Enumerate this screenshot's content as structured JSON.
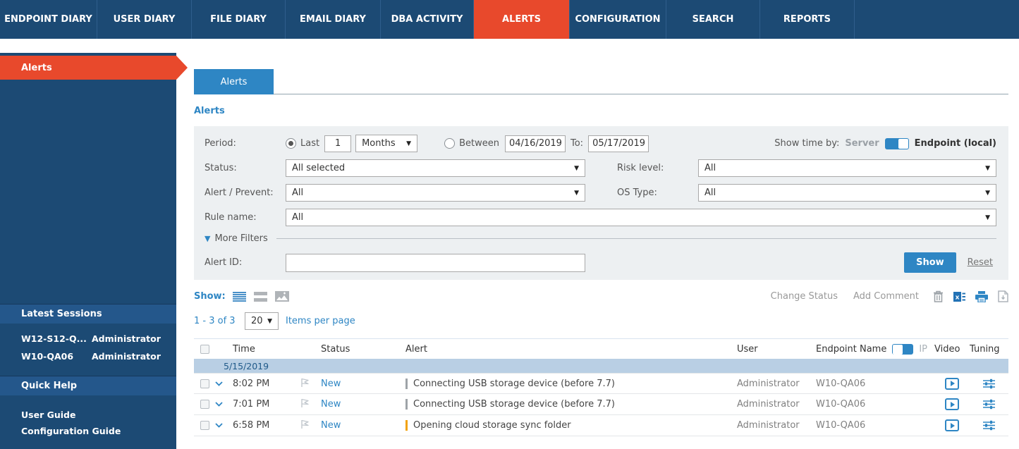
{
  "nav": {
    "items": [
      {
        "label": "ENDPOINT DIARY"
      },
      {
        "label": "USER DIARY"
      },
      {
        "label": "FILE DIARY"
      },
      {
        "label": "EMAIL DIARY"
      },
      {
        "label": "DBA ACTIVITY"
      },
      {
        "label": "ALERTS",
        "active": true
      },
      {
        "label": "CONFIGURATION"
      },
      {
        "label": "SEARCH"
      },
      {
        "label": "REPORTS"
      }
    ]
  },
  "sidebar": {
    "active_item": "Alerts",
    "latest_sessions": {
      "title": "Latest Sessions",
      "sessions": [
        {
          "endpoint": "W12-S12-Q...",
          "user": "Administrator"
        },
        {
          "endpoint": "W10-QA06",
          "user": "Administrator"
        }
      ]
    },
    "quick_help": {
      "title": "Quick Help",
      "links": {
        "user_guide": "User Guide",
        "configuration_guide": "Configuration Guide"
      }
    }
  },
  "main": {
    "tab": "Alerts",
    "breadcrumb": "Alerts",
    "filters": {
      "period": {
        "label": "Period:",
        "last_label": "Last",
        "last_value": "1",
        "unit": "Months",
        "between_label": "Between",
        "from": "04/16/2019",
        "to_label": "To:",
        "to": "05/17/2019"
      },
      "show_time_by": {
        "label": "Show time by:",
        "off_option": "Server",
        "on_option": "Endpoint (local)"
      },
      "status": {
        "label": "Status:",
        "value": "All selected"
      },
      "risk_level": {
        "label": "Risk level:",
        "value": "All"
      },
      "alert_prevent": {
        "label": "Alert / Prevent:",
        "value": "All"
      },
      "os_type": {
        "label": "OS Type:",
        "value": "All"
      },
      "rule_name": {
        "label": "Rule name:",
        "value": "All"
      },
      "more_filters": "More Filters",
      "alert_id": {
        "label": "Alert ID:",
        "value": ""
      },
      "show_button": "Show",
      "reset_link": "Reset"
    },
    "toolbar": {
      "show_label": "Show:",
      "change_status": "Change Status",
      "add_comment": "Add Comment"
    },
    "pagination": {
      "range": "1 - 3 of 3",
      "page_size": "20",
      "items_per_page": "Items per page"
    },
    "table": {
      "columns": {
        "time": "Time",
        "status": "Status",
        "alert": "Alert",
        "user": "User",
        "endpoint_name": "Endpoint Name",
        "ip": "IP",
        "video": "Video",
        "tuning": "Tuning"
      },
      "group_date": "5/15/2019",
      "rows": [
        {
          "time": "8:02 PM",
          "status": "New",
          "alert": "Connecting USB storage device (before 7.7)",
          "severity_color": "#9EA3A8",
          "user": "Administrator",
          "endpoint": "W10-QA06"
        },
        {
          "time": "7:01 PM",
          "status": "New",
          "alert": "Connecting USB storage device (before 7.7)",
          "severity_color": "#9EA3A8",
          "user": "Administrator",
          "endpoint": "W10-QA06"
        },
        {
          "time": "6:58 PM",
          "status": "New",
          "alert": "Opening cloud storage sync folder",
          "severity_color": "#F2A20C",
          "user": "Administrator",
          "endpoint": "W10-QA06"
        }
      ]
    }
  },
  "colors": {
    "nav_bg": "#1C4A74",
    "accent_red": "#E8492C",
    "link_blue": "#2E86C4",
    "panel_bg": "#EDF0F2",
    "date_row_bg": "#B9CFE4",
    "severity_gray": "#9EA3A8",
    "severity_orange": "#F2A20C"
  }
}
